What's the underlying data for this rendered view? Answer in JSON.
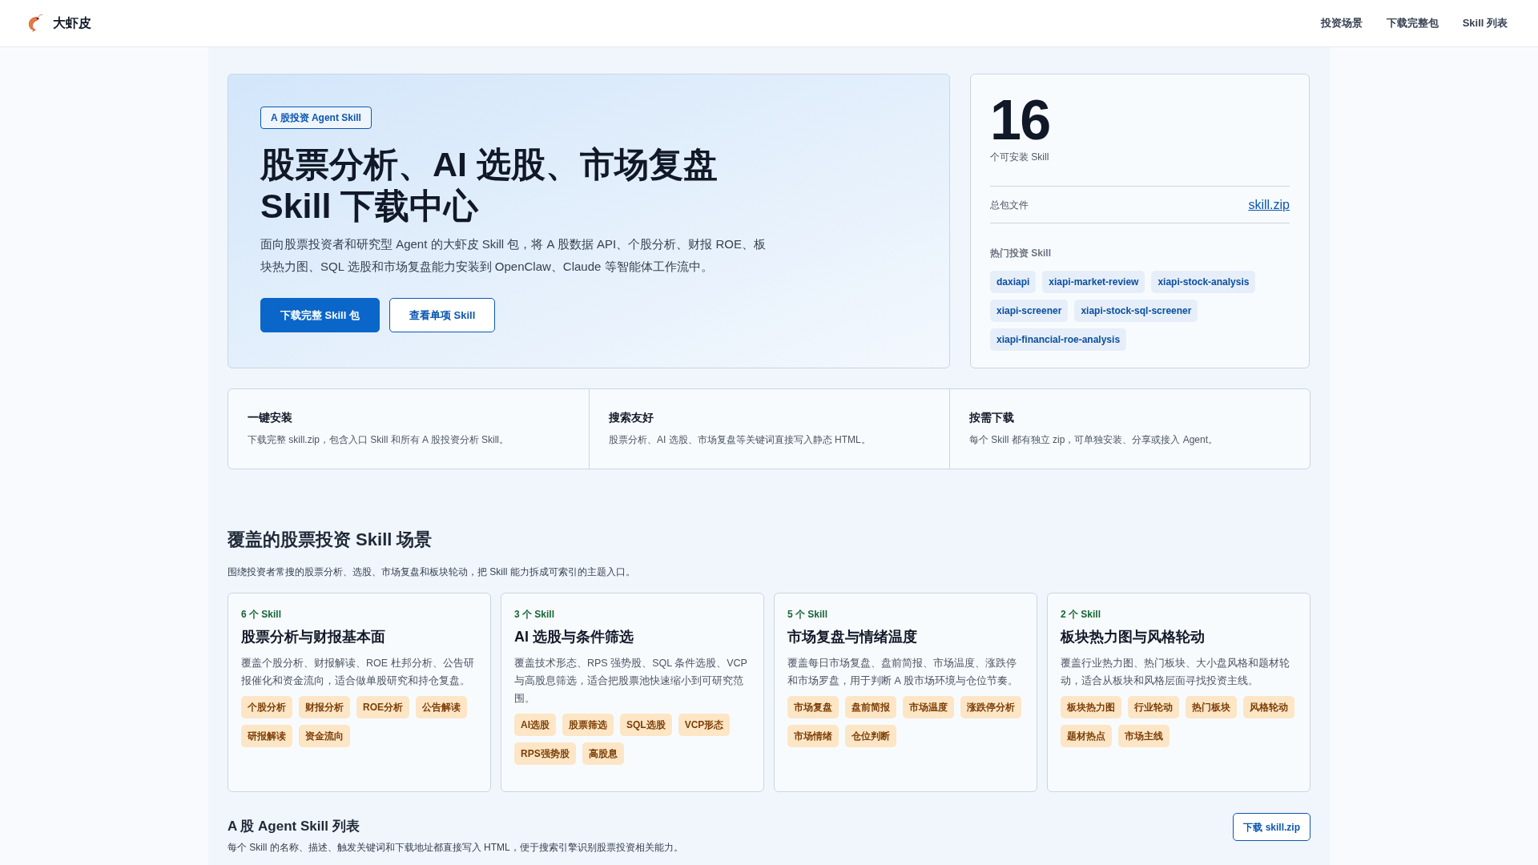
{
  "header": {
    "brand": "大虾皮",
    "nav": [
      "投资场景",
      "下载完整包",
      "Skill 列表"
    ]
  },
  "hero": {
    "badge": "A 股投资 Agent Skill",
    "title_lines": [
      "股票分析、AI 选股、市场复盘",
      "Skill 下载中心"
    ],
    "description": "面向股票投资者和研究型 Agent 的大虾皮 Skill 包，将 A 股数据 API、个股分析、财报 ROE、板块热力图、SQL 选股和市场复盘能力安装到 OpenClaw、Claude 等智能体工作流中。",
    "buttons": [
      {
        "label": "下载完整 Skill 包",
        "kind": "primary"
      },
      {
        "label": "查看单项 Skill",
        "kind": "outline"
      }
    ]
  },
  "stats": {
    "count": "16",
    "count_label": "个可安装 Skill",
    "package_label": "总包文件",
    "package_link": "skill.zip",
    "hot_title": "热门投资 Skill",
    "hot_skills": [
      "daxiapi",
      "xiapi-market-review",
      "xiapi-stock-analysis",
      "xiapi-screener",
      "xiapi-stock-sql-screener",
      "xiapi-financial-roe-analysis"
    ]
  },
  "features": [
    {
      "title": "一键安装",
      "text": "下载完整 skill.zip，包含入口 Skill 和所有 A 股投资分析 Skill。"
    },
    {
      "title": "搜索友好",
      "text": "股票分析、AI 选股、市场复盘等关键词直接写入静态 HTML。"
    },
    {
      "title": "按需下载",
      "text": "每个 Skill 都有独立 zip，可单独安装、分享或接入 Agent。"
    }
  ],
  "scenarios": {
    "title": "覆盖的股票投资 Skill 场景",
    "subtitle": "围绕投资者常搜的股票分析、选股、市场复盘和板块轮动，把 Skill 能力拆成可索引的主题入口。",
    "cards": [
      {
        "count": "6 个 Skill",
        "title": "股票分析与财报基本面",
        "text": "覆盖个股分析、财报解读、ROE 杜邦分析、公告研报催化和资金流向，适合做单股研究和持仓复盘。",
        "tags": [
          "个股分析",
          "财报分析",
          "ROE分析",
          "公告解读",
          "研报解读",
          "资金流向"
        ]
      },
      {
        "count": "3 个 Skill",
        "title": "AI 选股与条件筛选",
        "text": "覆盖技术形态、RPS 强势股、SQL 条件选股、VCP 与高股息筛选，适合把股票池快速缩小到可研究范围。",
        "tags": [
          "AI选股",
          "股票筛选",
          "SQL选股",
          "VCP形态",
          "RPS强势股",
          "高股息"
        ]
      },
      {
        "count": "5 个 Skill",
        "title": "市场复盘与情绪温度",
        "text": "覆盖每日市场复盘、盘前简报、市场温度、涨跌停和市场罗盘，用于判断 A 股市场环境与仓位节奏。",
        "tags": [
          "市场复盘",
          "盘前简报",
          "市场温度",
          "涨跌停分析",
          "市场情绪",
          "仓位判断"
        ]
      },
      {
        "count": "2 个 Skill",
        "title": "板块热力图与风格轮动",
        "text": "覆盖行业热力图、热门板块、大小盘风格和题材轮动，适合从板块和风格层面寻找投资主线。",
        "tags": [
          "板块热力图",
          "行业轮动",
          "热门板块",
          "风格轮动",
          "题材热点",
          "市场主线"
        ]
      }
    ]
  },
  "skill_list": {
    "title": "A 股 Agent Skill 列表",
    "subtitle": "每个 Skill 的名称、描述、触发关键词和下载地址都直接写入 HTML，便于搜索引擎识别股票投资相关能力。",
    "button": "下载 skill.zip"
  }
}
